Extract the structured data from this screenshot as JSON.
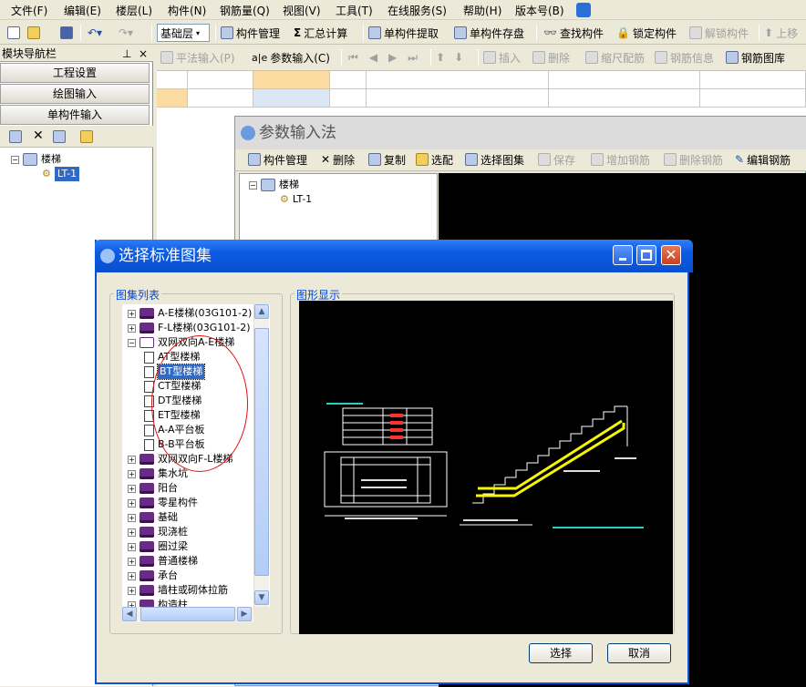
{
  "menu": [
    "文件(F)",
    "编辑(E)",
    "楼层(L)",
    "构件(N)",
    "钢筋量(Q)",
    "视图(V)",
    "工具(T)",
    "在线服务(S)",
    "帮助(H)",
    "版本号(B)"
  ],
  "toolbar1": {
    "floor_select": "基础层",
    "component_manage": "构件管理",
    "sum_calc": "汇总计算",
    "single_extract": "单构件提取",
    "single_save": "单构件存盘",
    "find_component": "查找构件",
    "lock_component": "锁定构件",
    "unlock_component": "解锁构件",
    "move_up": "上移"
  },
  "toolbar2": {
    "flat_input": "平法输入(P)",
    "param_input": "参数输入(C)",
    "insert": "插入",
    "delete": "删除",
    "scale_rebar": "缩尺配筋",
    "rebar_info": "钢筋信息",
    "rebar_library": "钢筋图库"
  },
  "nav": {
    "title": "模块导航栏",
    "pin": "ㅁ",
    "close": "×",
    "project_settings": "工程设置",
    "drawing_input": "绘图输入",
    "single_input": "单构件输入",
    "tree_root": "楼梯",
    "tree_child": "LT-1"
  },
  "param_window": {
    "title": "参数输入法",
    "component_manage": "构件管理",
    "delete": "删除",
    "copy": "复制",
    "select_match": "选配",
    "select_atlas": "选择图集",
    "save": "保存",
    "add_rebar": "增加钢筋",
    "delete_rebar": "删除钢筋",
    "edit_rebar": "编辑钢筋",
    "tree_root": "楼梯",
    "tree_child": "LT-1"
  },
  "dialog": {
    "title": "选择标准图集",
    "list_label": "图集列表",
    "preview_label": "图形显示",
    "select_button": "选择",
    "cancel_button": "取消",
    "tree": [
      {
        "label": "A-E楼梯(03G101-2)",
        "expanded": false
      },
      {
        "label": "F-L楼梯(03G101-2)",
        "expanded": false
      },
      {
        "label": "双网双向A-E楼梯",
        "expanded": true
      },
      {
        "label": "AT型楼梯",
        "child": true
      },
      {
        "label": "BT型楼梯",
        "child": true,
        "selected": true
      },
      {
        "label": "CT型楼梯",
        "child": true
      },
      {
        "label": "DT型楼梯",
        "child": true
      },
      {
        "label": "ET型楼梯",
        "child": true
      },
      {
        "label": "A-A平台板",
        "child": true
      },
      {
        "label": "B-B平台板",
        "child": true
      },
      {
        "label": "双网双向F-L楼梯",
        "expanded": false
      },
      {
        "label": "集水坑",
        "expanded": false
      },
      {
        "label": "阳台",
        "expanded": false
      },
      {
        "label": "零星构件",
        "expanded": false
      },
      {
        "label": "基础",
        "expanded": false
      },
      {
        "label": "现浇桩",
        "expanded": false
      },
      {
        "label": "圈过梁",
        "expanded": false
      },
      {
        "label": "普通楼梯",
        "expanded": false
      },
      {
        "label": "承台",
        "expanded": false
      },
      {
        "label": "墙柱或砌体拉筋",
        "expanded": false
      },
      {
        "label": "构造柱",
        "expanded": false
      }
    ]
  },
  "colors": {
    "xp_blue": "#0a53d8",
    "selected": "#316ac5",
    "highlight_cell": "#fcdba0"
  }
}
